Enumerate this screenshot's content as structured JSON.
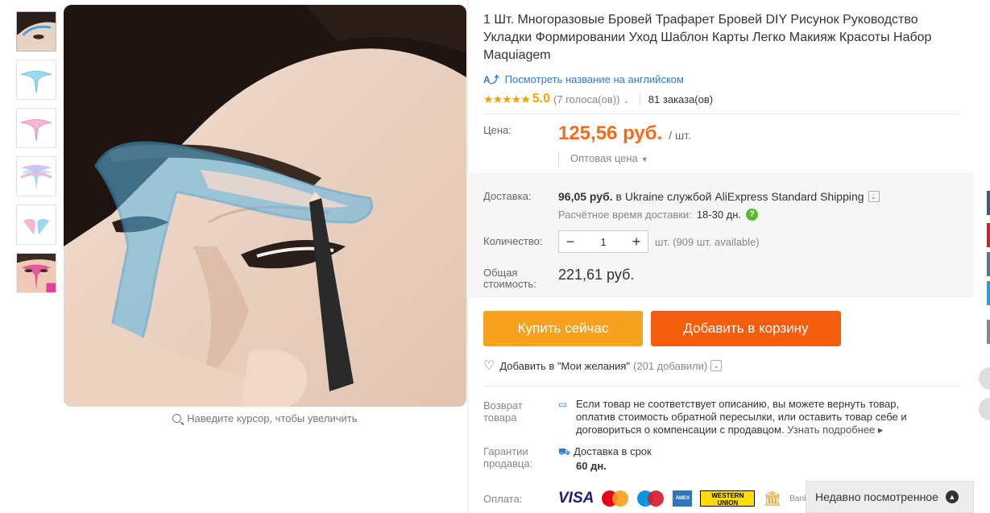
{
  "product": {
    "title": "1 Шт. Многоразовые Бровей Трафарет Бровей DIY Рисунок Руководство Укладки Формировании Уход Шаблон Карты Легко Макияж Красоты Набор Maquiagem",
    "translate_link": "Посмотреть название на английском",
    "stars": "★★★★★",
    "rating": "5.0",
    "votes": "(7 голоса(ов))",
    "orders": "81 заказа(ов)"
  },
  "gallery": {
    "zoom_hint": "Наведите курсор, чтобы увеличить",
    "thumbnails": [
      "thumb-1",
      "thumb-2",
      "thumb-3",
      "thumb-4",
      "thumb-5",
      "thumb-6"
    ]
  },
  "price": {
    "label": "Цена:",
    "value": "125,56 руб.",
    "unit": "/ шт.",
    "wholesale": "Оптовая цена"
  },
  "shipping": {
    "label": "Доставка:",
    "price": "96,05 руб.",
    "text": "в Ukraine службой AliExpress Standard Shipping",
    "eta_label": "Расчётное время доставки:",
    "eta_days": "18-30 дн."
  },
  "quantity": {
    "label": "Количество:",
    "value": "1",
    "unit": "шт.",
    "available": "(909 шт. available)"
  },
  "total": {
    "label": "Общая стоимость:",
    "value": "221,61 руб."
  },
  "buttons": {
    "buy_now": "Купить сейчас",
    "add_to_cart": "Добавить в корзину"
  },
  "wishlist": {
    "label": "Добавить в \"Мои желания\"",
    "count": "(201 добавили)"
  },
  "returns": {
    "label": "Возврат товара",
    "text": "Если товар не соответствует описанию, вы можете вернуть товар, оплатив стоимость обратной пересылки, или оставить товар себе и договориться о компенсации с продавцом.",
    "more": "Узнать подробнее"
  },
  "guarantee": {
    "label": "Гарантии продавца:",
    "text": "Доставка в срок",
    "days": "60 дн."
  },
  "payment": {
    "label": "Оплата:",
    "methods": [
      "VISA",
      "MasterCard",
      "Maestro",
      "AMEX",
      "WESTERN UNION",
      "Bank Transfer"
    ]
  },
  "recently_viewed": {
    "label": "Недавно посмотренное"
  },
  "colors": {
    "price": "#f56d1b",
    "buy_now": "#f7a21f",
    "add_to_cart": "#f55d0f",
    "link": "#2e7bd8",
    "stars": "#f7a200",
    "help": "#5cb531"
  },
  "social_colors": [
    "#3b5998",
    "#cb2027",
    "#4a76a8",
    "#1da1f2",
    "#888888"
  ]
}
